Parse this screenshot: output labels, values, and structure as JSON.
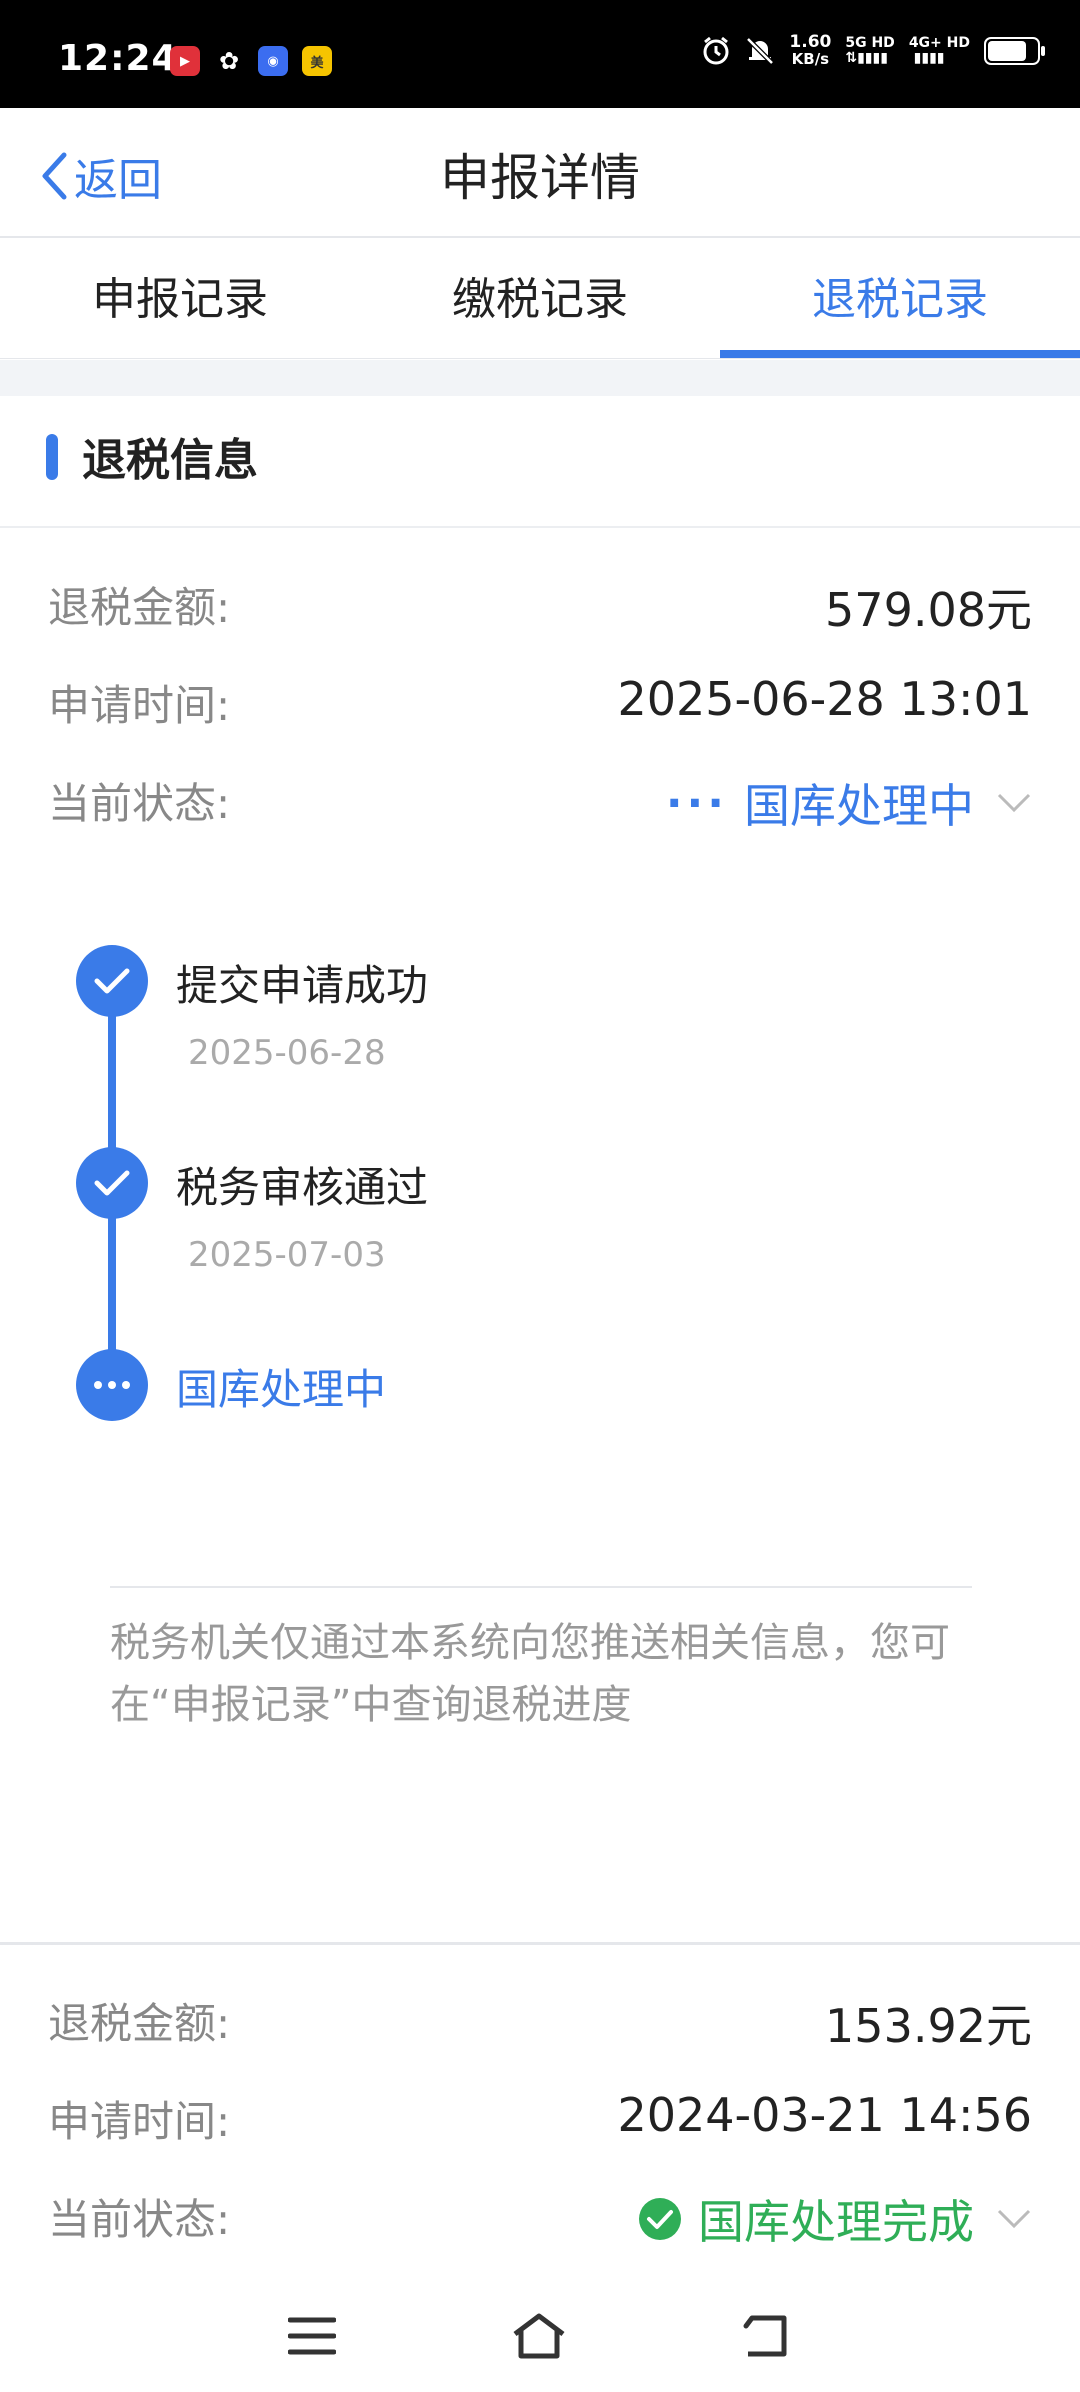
{
  "status_bar": {
    "time": "12:24",
    "net_speed": "1.60",
    "net_unit": "KB/s",
    "sig1": "5G HD",
    "sig2": "4G+ HD",
    "app_icons": [
      "video-app-icon",
      "wechat-icon",
      "qq-icon",
      "meituan-icon"
    ],
    "battery_level": 0.8
  },
  "header": {
    "back_label": "返回",
    "title": "申报详情"
  },
  "tabs": [
    {
      "label": "申报记录",
      "active": false
    },
    {
      "label": "缴税记录",
      "active": false
    },
    {
      "label": "退税记录",
      "active": true
    }
  ],
  "section": {
    "title": "退税信息"
  },
  "records": [
    {
      "amount_label": "退税金额:",
      "amount": "579.08元",
      "time_label": "申请时间:",
      "time": "2025-06-28 13:01",
      "status_label": "当前状态:",
      "status": "国库处理中",
      "status_color": "#3a7be8",
      "timeline": [
        {
          "title": "提交申请成功",
          "date": "2025-06-28",
          "state": "done"
        },
        {
          "title": "税务审核通过",
          "date": "2025-07-03",
          "state": "done"
        },
        {
          "title": "国库处理中",
          "date": "",
          "state": "current"
        }
      ],
      "notice": "税务机关仅通过本系统向您推送相关信息，您可在“申报记录”中查询退税进度"
    },
    {
      "amount_label": "退税金额:",
      "amount": "153.92元",
      "time_label": "申请时间:",
      "time": "2024-03-21 14:56",
      "status_label": "当前状态:",
      "status": "国库处理完成",
      "status_color": "#2fae57"
    }
  ],
  "colors": {
    "accent": "#3a7be8",
    "success": "#2fae57"
  }
}
